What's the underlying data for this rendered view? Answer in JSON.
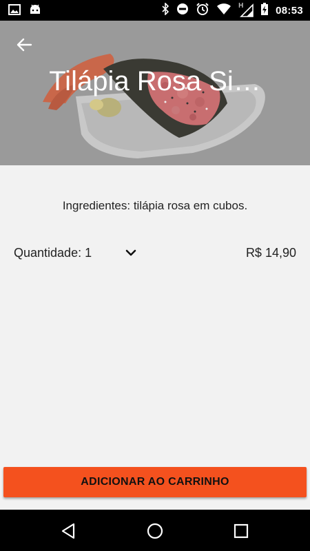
{
  "status_bar": {
    "time": "08:53",
    "left_icons": [
      "image-icon",
      "android-icon"
    ],
    "right_icons": [
      "bluetooth-icon",
      "do-not-disturb-icon",
      "alarm-icon",
      "wifi-icon",
      "hspa-signal-icon",
      "battery-charging-icon"
    ],
    "network_label": "H"
  },
  "header": {
    "title": "Tilápia Rosa Si…",
    "back_icon": "arrow-left-icon"
  },
  "product": {
    "ingredients": "Ingredientes: tilápia rosa em cubos.",
    "quantity_label": "Quantidade: 1",
    "quantity_icon": "chevron-down-icon",
    "price": "R$ 14,90"
  },
  "actions": {
    "add_to_cart": "ADICIONAR AO CARRINHO"
  },
  "nav": {
    "icons": [
      "back-triangle-icon",
      "home-circle-icon",
      "recents-square-icon"
    ]
  },
  "colors": {
    "accent": "#f4511e",
    "background": "#f2f2f2"
  }
}
